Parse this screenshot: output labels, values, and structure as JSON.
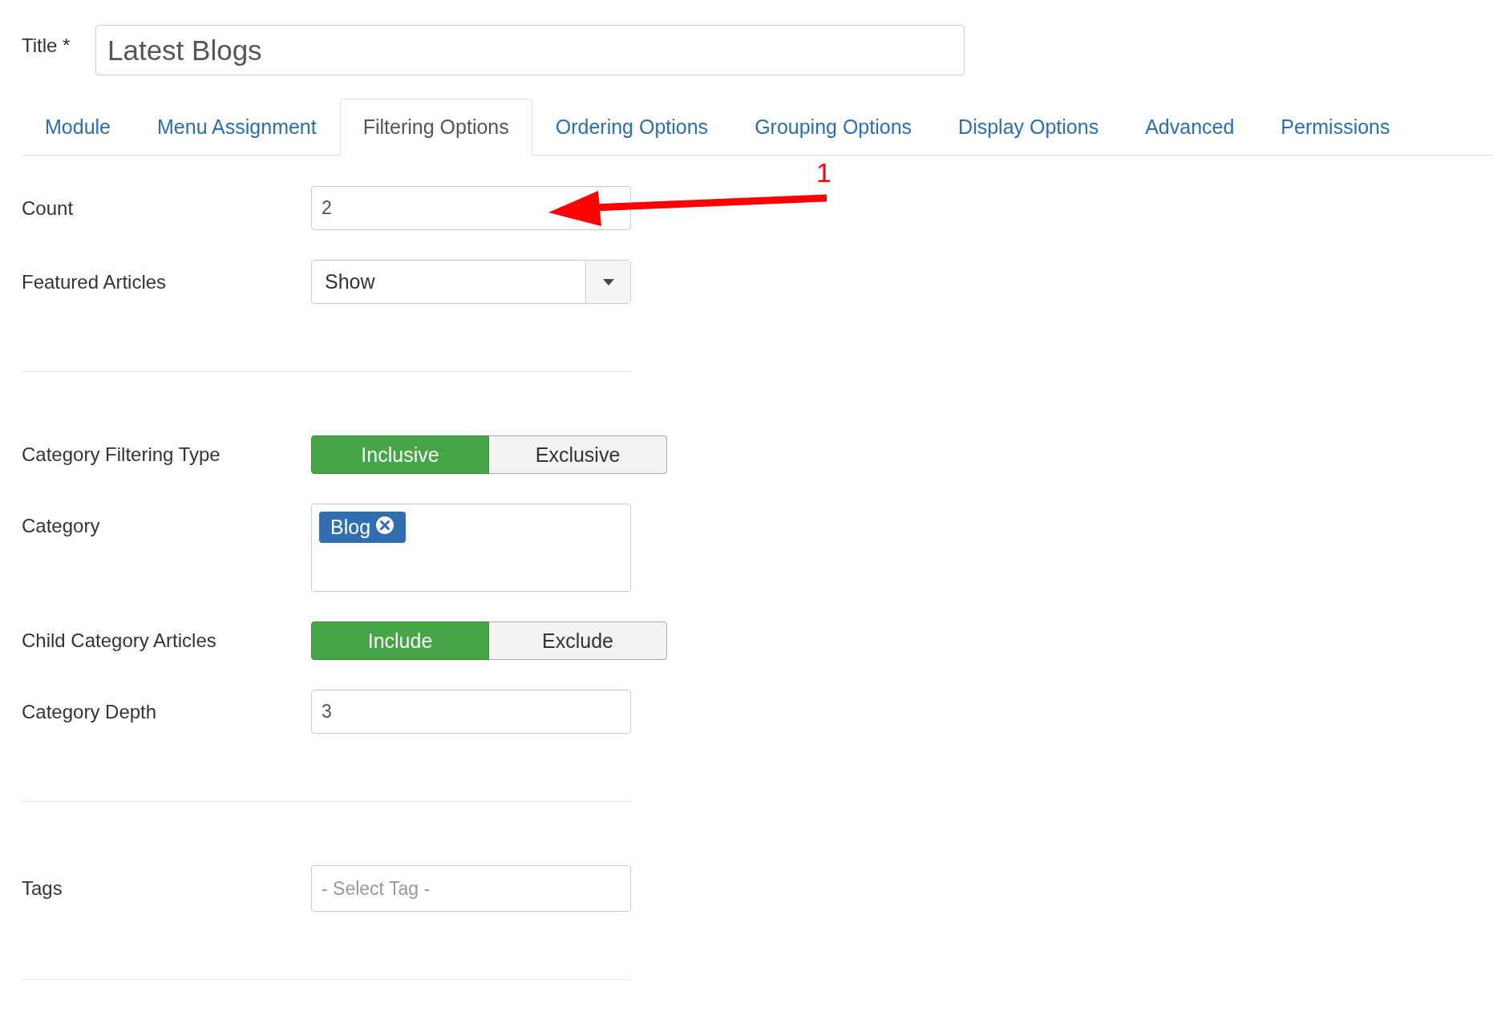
{
  "title_field": {
    "label": "Title *",
    "value": "Latest Blogs"
  },
  "tabs": [
    {
      "label": "Module",
      "selected": false
    },
    {
      "label": "Menu Assignment",
      "selected": false
    },
    {
      "label": "Filtering Options",
      "selected": true
    },
    {
      "label": "Ordering Options",
      "selected": false
    },
    {
      "label": "Grouping Options",
      "selected": false
    },
    {
      "label": "Display Options",
      "selected": false
    },
    {
      "label": "Advanced",
      "selected": false
    },
    {
      "label": "Permissions",
      "selected": false
    }
  ],
  "sections": [
    [
      {
        "kind": "text",
        "label": "Count",
        "value": "2"
      },
      {
        "kind": "select",
        "label": "Featured Articles",
        "value": "Show"
      }
    ],
    [
      {
        "kind": "toggle",
        "label": "Category Filtering Type",
        "options": [
          {
            "label": "Inclusive",
            "selected": true
          },
          {
            "label": "Exclusive",
            "selected": false
          }
        ]
      },
      {
        "kind": "tags",
        "label": "Category",
        "chips": [
          "Blog"
        ]
      },
      {
        "kind": "toggle",
        "label": "Child Category Articles",
        "options": [
          {
            "label": "Include",
            "selected": true
          },
          {
            "label": "Exclude",
            "selected": false
          }
        ]
      },
      {
        "kind": "text",
        "label": "Category Depth",
        "value": "3"
      }
    ],
    [
      {
        "kind": "search",
        "label": "Tags",
        "placeholder": "- Select Tag -"
      }
    ]
  ],
  "callout": {
    "number": "1"
  }
}
